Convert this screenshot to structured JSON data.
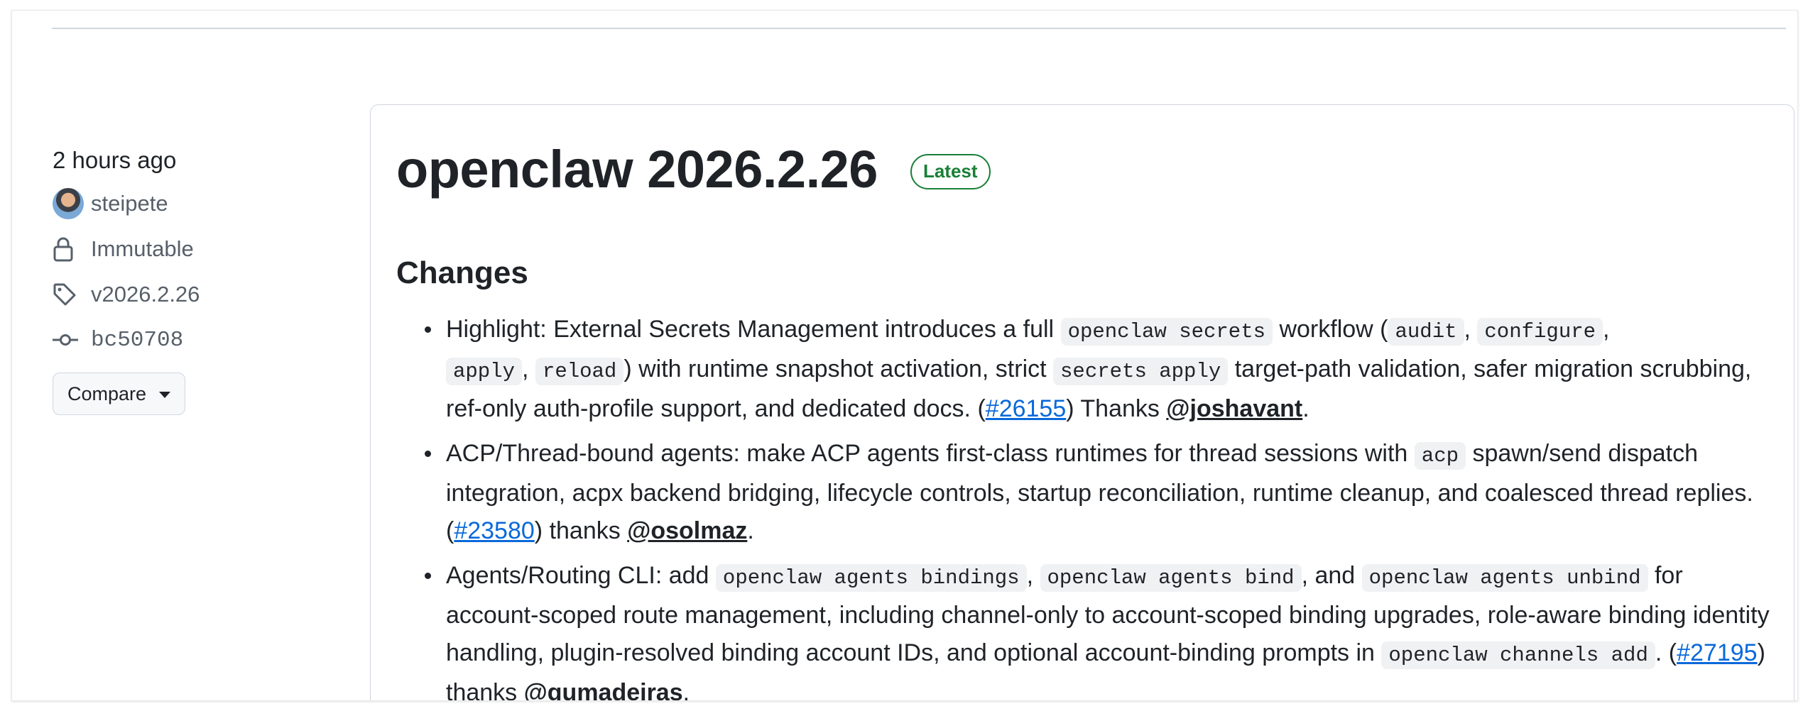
{
  "sidebar": {
    "time": "2 hours ago",
    "author": "steipete",
    "immutable": "Immutable",
    "tag": "v2026.2.26",
    "commit": "bc50708",
    "compare_label": "Compare"
  },
  "release": {
    "title": "openclaw 2026.2.26",
    "badge": "Latest",
    "section": "Changes",
    "items": [
      {
        "p1": "Highlight: External Secrets Management introduces a full ",
        "c1": "openclaw secrets",
        "p2": " workflow (",
        "c2": "audit",
        "p3": ", ",
        "c3": "configure",
        "p4": ", ",
        "c4": "apply",
        "p5": ", ",
        "c5": "reload",
        "p6": ") with runtime snapshot activation, strict ",
        "c6": "secrets apply",
        "p7": " target-path validation, safer migration scrubbing, ref-only auth-profile support, and dedicated docs. (",
        "issue": "#26155",
        "p8": ") Thanks ",
        "user": "@joshavant",
        "p9": "."
      },
      {
        "p1": "ACP/Thread-bound agents: make ACP agents first-class runtimes for thread sessions with ",
        "c1": "acp",
        "p2": " spawn/send dispatch integration, acpx backend bridging, lifecycle controls, startup reconciliation, runtime cleanup, and coalesced thread replies. (",
        "issue": "#23580",
        "p3": ") thanks ",
        "user": "@osolmaz",
        "p4": "."
      },
      {
        "p1": "Agents/Routing CLI: add ",
        "c1": "openclaw agents bindings",
        "p2": ", ",
        "c2": "openclaw agents bind",
        "p3": ", and ",
        "c3": "openclaw agents unbind",
        "p4": " for account-scoped route management, including channel-only to account-scoped binding upgrades, role-aware binding identity handling, plugin-resolved binding account IDs, and optional account-binding prompts in ",
        "c4": "openclaw channels add",
        "p5": ". (",
        "issue": "#27195",
        "p6": ") thanks ",
        "user": "@gumadeiras",
        "p7": "."
      }
    ]
  },
  "colors": {
    "latest_badge": "#1a7f37",
    "link": "#0969da",
    "muted": "#57606a"
  },
  "icons": [
    "avatar",
    "lock-icon",
    "tag-icon",
    "commit-icon",
    "caret-down-icon"
  ]
}
